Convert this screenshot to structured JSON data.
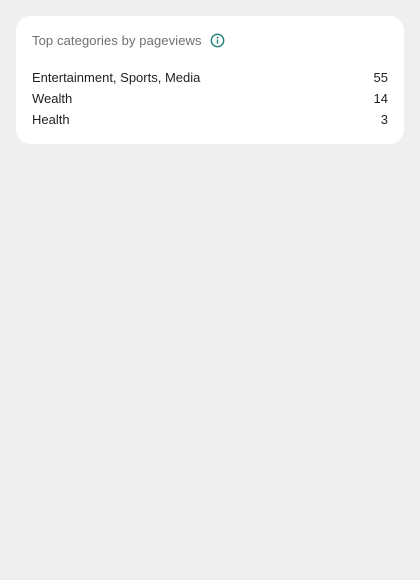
{
  "card": {
    "title": "Top categories by pageviews",
    "info_icon": "info-icon",
    "accent_color": "#1a7f76",
    "rows": [
      {
        "label": "Entertainment, Sports, Media",
        "value": "55"
      },
      {
        "label": "Wealth",
        "value": "14"
      },
      {
        "label": "Health",
        "value": "3"
      }
    ]
  }
}
